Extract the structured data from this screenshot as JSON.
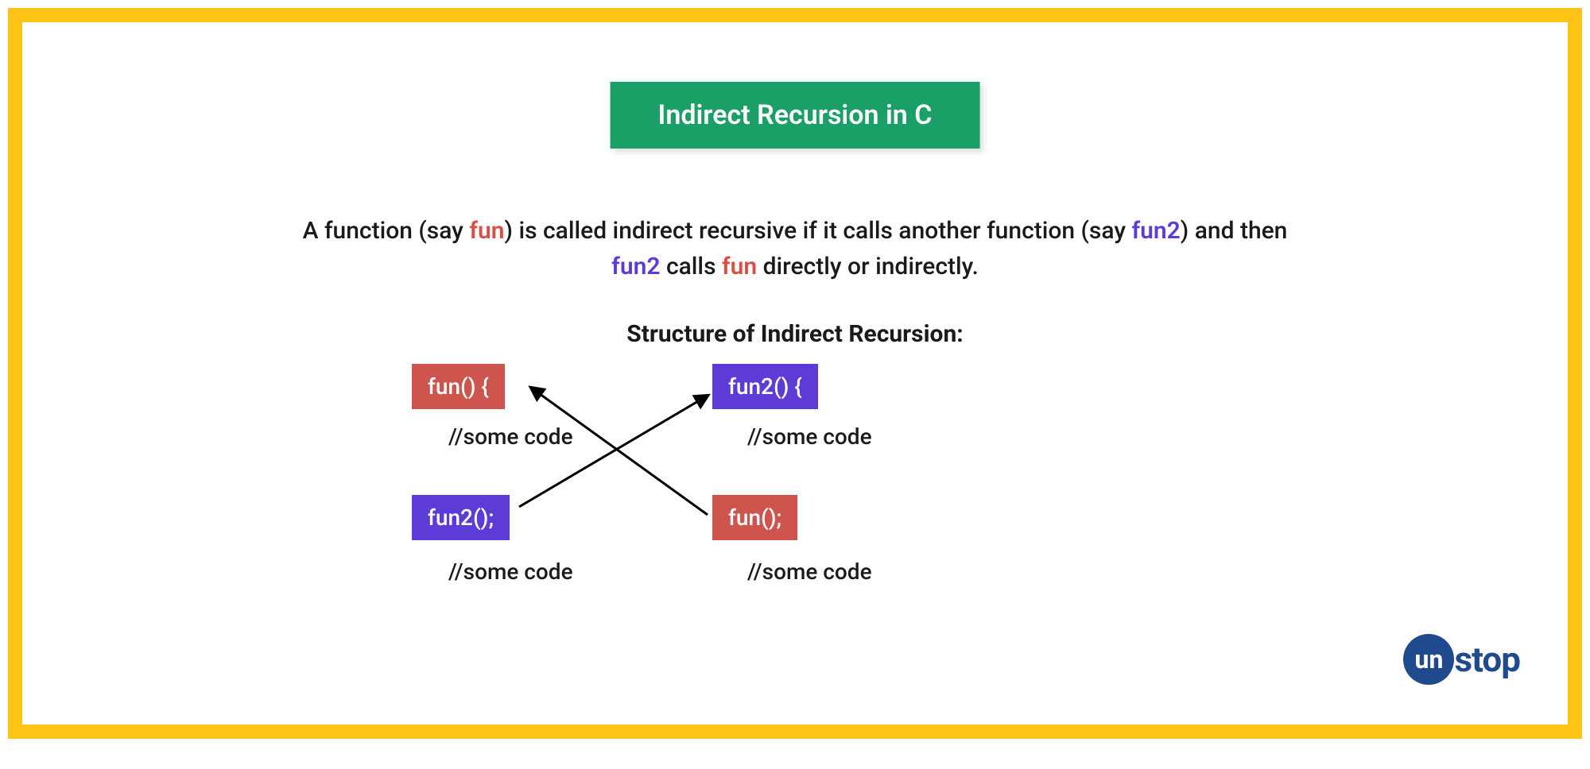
{
  "title": "Indirect Recursion in C",
  "description": {
    "pre1": "A function (say ",
    "fun1": "fun",
    "mid1": ") is called indirect recursive if it calls another function (say ",
    "fun2a": "fun2",
    "mid2": ") and then ",
    "fun2b": "fun2",
    "mid3": " calls ",
    "funb": "fun",
    "post": " directly or indirectly."
  },
  "structure_heading": "Structure of Indirect Recursion:",
  "boxes": {
    "fun_decl": "fun() {",
    "fun2_decl": "fun2() {",
    "fun2_call": "fun2();",
    "fun_call": "fun();"
  },
  "comment": "//some code",
  "logo": {
    "circle": "un",
    "text": "stop"
  }
}
